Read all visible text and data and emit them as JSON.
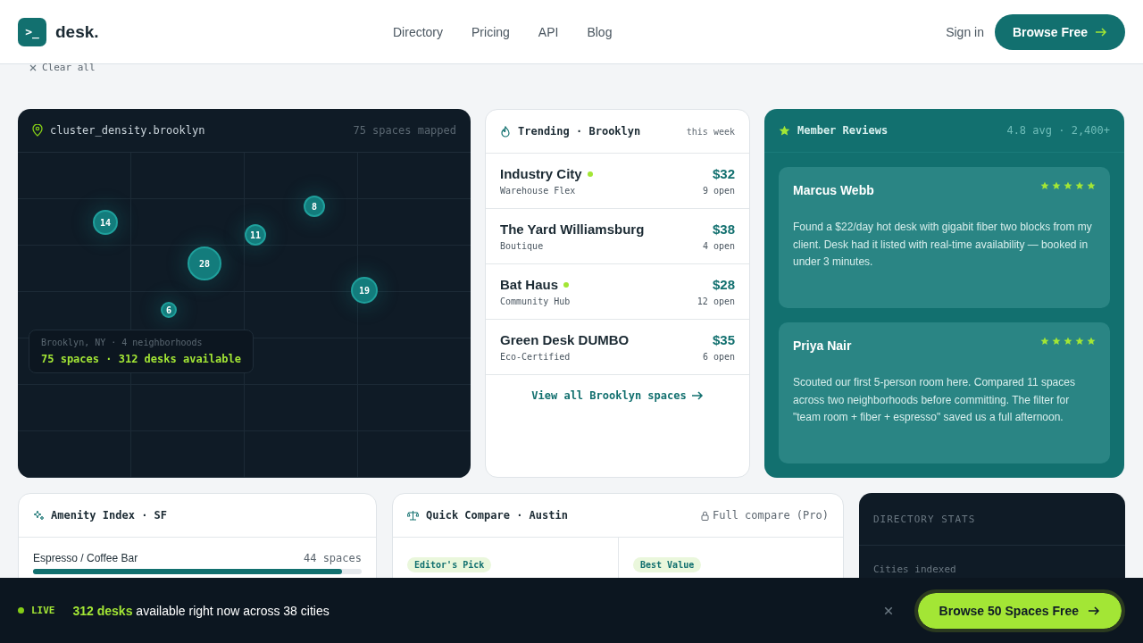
{
  "nav": {
    "logo_mark": ">_",
    "logo_name": "desk.",
    "links": [
      "Directory",
      "Pricing",
      "API",
      "Blog"
    ],
    "sign_in": "Sign in",
    "cta": "Browse Free"
  },
  "filters": {
    "clear": "Clear all"
  },
  "map": {
    "title": "cluster_density.brooklyn",
    "count": "75 spaces mapped",
    "clusters": [
      {
        "label": "14"
      },
      {
        "label": "8"
      },
      {
        "label": "11"
      },
      {
        "label": "28"
      },
      {
        "label": "19"
      },
      {
        "label": "6"
      }
    ],
    "summary_place": "Brooklyn, NY · 4 neighborhoods",
    "summary_total": "75 spaces · 312 desks available"
  },
  "trending": {
    "title": "Trending · Brooklyn",
    "period": "this week",
    "items": [
      {
        "name": "Industry City",
        "tag": "Warehouse Flex",
        "price": "$32",
        "open": "9 open",
        "live": true
      },
      {
        "name": "The Yard Williamsburg",
        "tag": "Boutique",
        "price": "$38",
        "open": "4 open",
        "live": false
      },
      {
        "name": "Bat Haus",
        "tag": "Community Hub",
        "price": "$28",
        "open": "12 open",
        "live": true
      },
      {
        "name": "Green Desk DUMBO",
        "tag": "Eco-Certified",
        "price": "$35",
        "open": "6 open",
        "live": false
      }
    ],
    "link": "View all Brooklyn spaces"
  },
  "reviews": {
    "title": "Member Reviews",
    "summary": "4.8 avg · 2,400+",
    "items": [
      {
        "name": "Marcus Webb",
        "stars": 5,
        "text": "Found a $22/day hot desk with gigabit fiber two blocks from my client. Desk had it listed with real-time availability — booked in under 3 minutes."
      },
      {
        "name": "Priya Nair",
        "stars": 5,
        "text": "Scouted our first 5-person room here. Compared 11 spaces across two neighborhoods before committing. The filter for \"team room + fiber + espresso\" saved us a full afternoon."
      }
    ]
  },
  "amenity": {
    "title": "Amenity Index · SF",
    "items": [
      {
        "label": "Espresso / Coffee Bar",
        "count": "44 spaces",
        "level": 0.94
      }
    ]
  },
  "compare": {
    "title": "Quick Compare · Austin",
    "lock": "Full compare (Pro)",
    "columns": [
      {
        "badge": "Editor's Pick"
      },
      {
        "badge": "Best Value"
      }
    ]
  },
  "stats": {
    "title": "DIRECTORY STATS",
    "rows": [
      {
        "label": "Cities indexed"
      }
    ]
  },
  "live_bar": {
    "badge": "LIVE",
    "message": "**312 desks** available right now across 38 cities",
    "cta": "Browse 50 Spaces Free"
  }
}
